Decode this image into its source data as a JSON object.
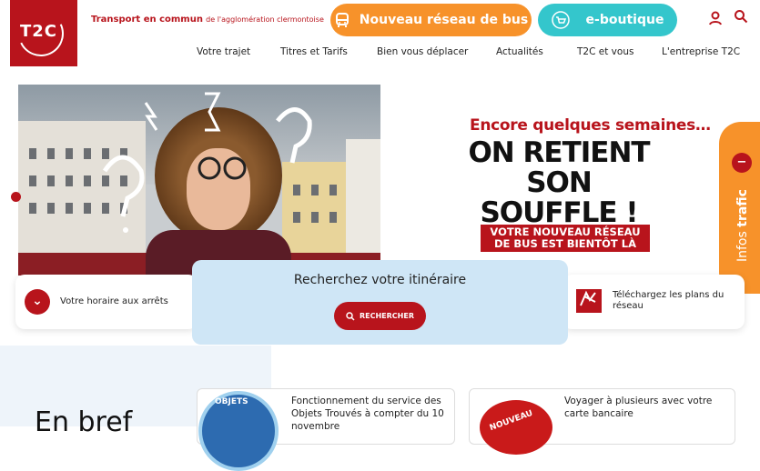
{
  "header": {
    "logo_text": "T2C",
    "tagline_main": "Transport en commun",
    "tagline_sub": "de l'agglomération clermontoise",
    "bus_button": "Nouveau réseau de bus",
    "shop_button": "e-boutique",
    "user_icon": "user-icon",
    "search_icon": "search-icon",
    "nav": [
      "Votre trajet",
      "Titres et Tarifs",
      "Bien vous déplacer",
      "Actualités",
      "T2C et vous",
      "L'entreprise T2C"
    ]
  },
  "hero": {
    "line1": "Encore quelques semaines…",
    "line2": "ON RETIENT",
    "line3": "SON SOUFFLE !",
    "line4": "VOTRE NOUVEAU RÉSEAU",
    "line5": "DE BUS EST BIENTÔT LÀ"
  },
  "trafic": {
    "label_a": "Infos",
    "label_b": "trafic"
  },
  "cards": {
    "horaire": "Votre horaire aux arrêts",
    "plans": "Téléchargez les plans du réseau"
  },
  "search": {
    "title": "Recherchez votre itinéraire",
    "button": "RECHERCHER"
  },
  "bottom": {
    "heading": "En bref",
    "news1": "Fonctionnement du service des Objets Trouvés à compter du 10 novembre",
    "news1_badge": "OBJETS",
    "news2": "Voyager à plusieurs avec votre carte bancaire",
    "news2_badge": "NOUVEAU"
  },
  "colors": {
    "brand_red": "#b8141c",
    "orange": "#f7922a",
    "teal": "#34c6cc",
    "light_blue": "#cfe6f6"
  }
}
